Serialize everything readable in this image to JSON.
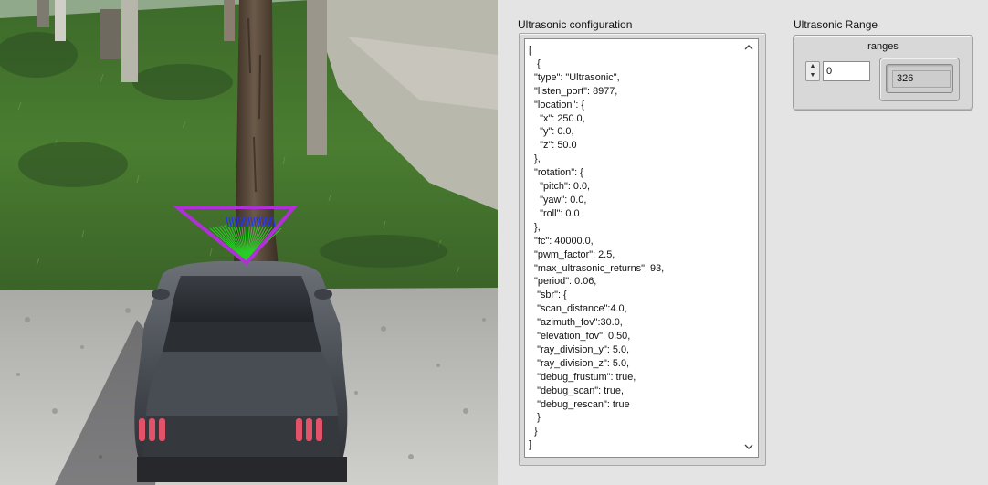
{
  "config": {
    "label": "Ultrasonic configuration",
    "text": "[\n   {\n  \"type\": \"Ultrasonic\",\n  \"listen_port\": 8977,\n  \"location\": {\n    \"x\": 250.0,\n    \"y\": 0.0,\n    \"z\": 50.0\n  },\n  \"rotation\": {\n    \"pitch\": 0.0,\n    \"yaw\": 0.0,\n    \"roll\": 0.0\n  },\n  \"fc\": 40000.0,\n  \"pwm_factor\": 2.5,\n  \"max_ultrasonic_returns\": 93,\n  \"period\": 0.06,\n   \"sbr\": {\n   \"scan_distance\":4.0,\n   \"azimuth_fov\":30.0,\n   \"elevation_fov\": 0.50,\n   \"ray_division_y\": 5.0,\n   \"ray_division_z\": 5.0,\n   \"debug_frustum\": true,\n   \"debug_scan\": true,\n   \"debug_rescan\": true\n   }\n  }\n]",
    "scroll_up_icon": "chevron-up-icon",
    "scroll_down_icon": "chevron-down-icon"
  },
  "range": {
    "label": "Ultrasonic Range",
    "array_label": "ranges",
    "index_value": "0",
    "value": "326"
  },
  "colors": {
    "frustum": "#b030d8",
    "scan_rays": "#22dd22",
    "rescan_rays": "#2233ee"
  }
}
